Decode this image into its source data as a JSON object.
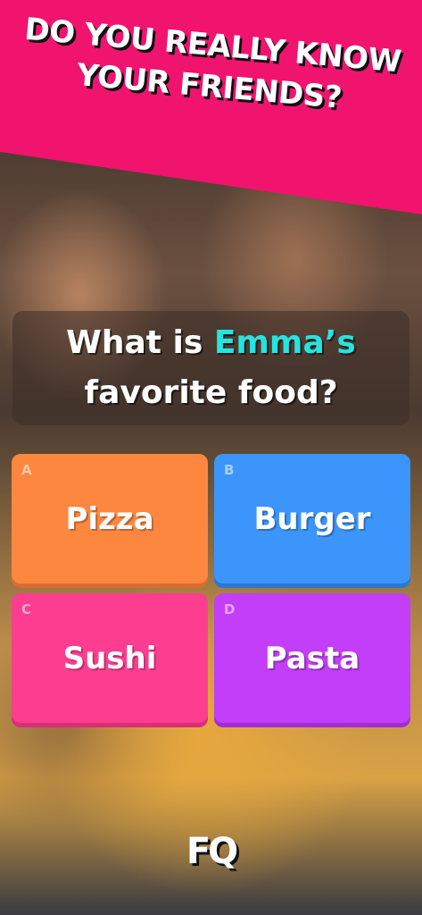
{
  "header": {
    "title_line1": "DO YOU REALLY KNOW",
    "title_line2": "YOUR FRIENDS?"
  },
  "question": {
    "prefix": "What is ",
    "name": "Emma’s",
    "line2": "favorite food?"
  },
  "answers": [
    {
      "letter": "A",
      "label": "Pizza",
      "color": "#fe8740"
    },
    {
      "letter": "B",
      "label": "Burger",
      "color": "#3b95fb"
    },
    {
      "letter": "C",
      "label": "Sushi",
      "color": "#fd3d90"
    },
    {
      "letter": "D",
      "label": "Pasta",
      "color": "#c23ef8"
    }
  ],
  "logo": "FQ",
  "colors": {
    "banner": "#f0146e",
    "highlight": "#25e4df"
  }
}
